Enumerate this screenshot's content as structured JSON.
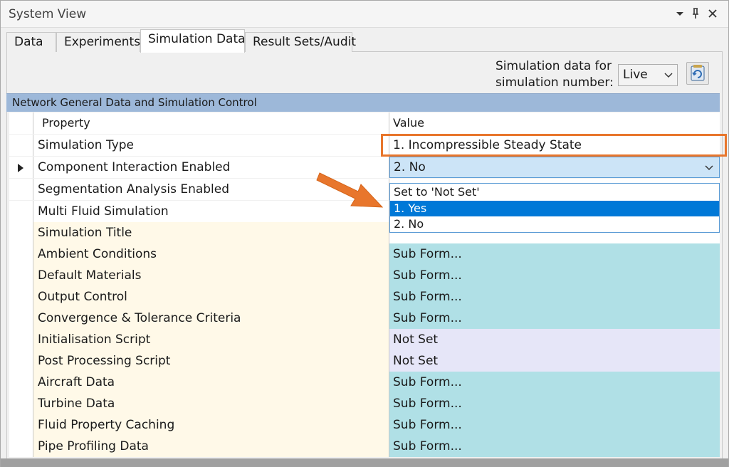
{
  "window": {
    "title": "System View",
    "controls": {
      "dropdown_icon": "▾",
      "pin_icon": "🖈",
      "close_icon": "✕"
    }
  },
  "tabs": [
    {
      "label": "Data",
      "active": false
    },
    {
      "label": "Experiments",
      "active": false
    },
    {
      "label": "Simulation Data",
      "active": true
    },
    {
      "label": "Result Sets/Audit",
      "active": false
    }
  ],
  "sim_number": {
    "label_line1": "Simulation data for",
    "label_line2": "simulation number:",
    "selected": "Live",
    "refresh_icon": "refresh-icon"
  },
  "section": {
    "title": "Network General Data and Simulation Control"
  },
  "grid": {
    "headers": {
      "property": "Property",
      "value": "Value"
    },
    "rows": [
      {
        "property": "Simulation Type",
        "value": "1. Incompressible Steady State"
      },
      {
        "property": "Component Interaction Enabled",
        "value": "2. No"
      },
      {
        "property": "Segmentation Analysis Enabled",
        "value": ""
      },
      {
        "property": "Multi Fluid Simulation",
        "value": ""
      },
      {
        "property": "Simulation Title",
        "value": ""
      },
      {
        "property": "Ambient Conditions",
        "value": "Sub Form..."
      },
      {
        "property": "Default Materials",
        "value": "Sub Form..."
      },
      {
        "property": "Output Control",
        "value": "Sub Form..."
      },
      {
        "property": "Convergence & Tolerance Criteria",
        "value": "Sub Form..."
      },
      {
        "property": "Initialisation Script",
        "value": "Not Set"
      },
      {
        "property": "Post Processing Script",
        "value": "Not Set"
      },
      {
        "property": "Aircraft Data",
        "value": "Sub Form..."
      },
      {
        "property": "Turbine Data",
        "value": "Sub Form..."
      },
      {
        "property": "Fluid Property Caching",
        "value": "Sub Form..."
      },
      {
        "property": "Pipe Profiling Data",
        "value": "Sub Form..."
      }
    ]
  },
  "dropdown": {
    "options": [
      "Set to 'Not Set'",
      "1. Yes",
      "2. No"
    ],
    "selected": "1. Yes"
  },
  "annotation_colors": {
    "highlight": "#e8762c",
    "arrow": "#e8762c"
  }
}
